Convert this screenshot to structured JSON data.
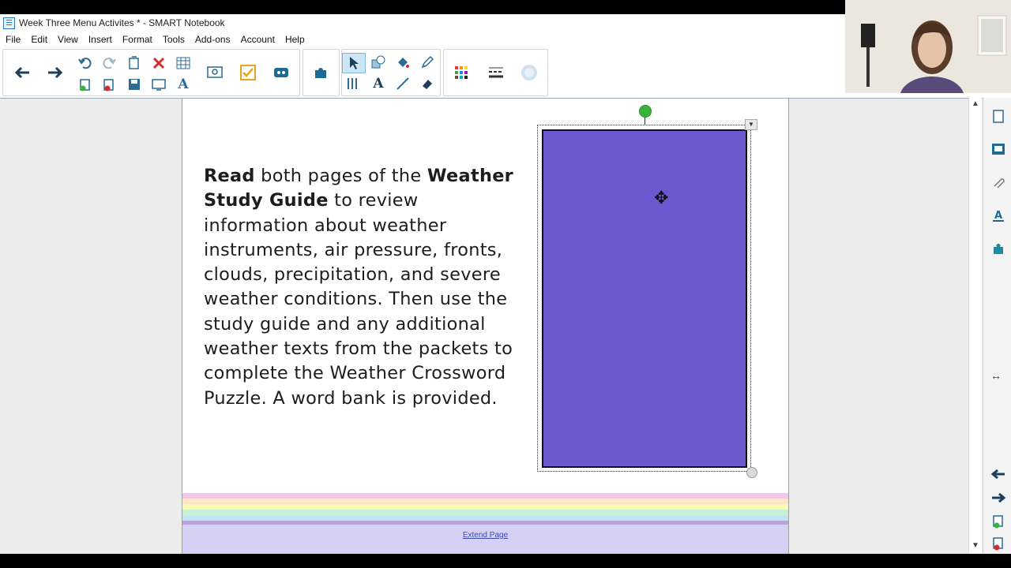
{
  "window": {
    "title": "Week Three Menu Activites * - SMART Notebook"
  },
  "menubar": {
    "items": [
      "File",
      "Edit",
      "View",
      "Insert",
      "Format",
      "Tools",
      "Add-ons",
      "Account",
      "Help"
    ]
  },
  "toolbar": {
    "buttons": [
      "back-arrow-icon",
      "forward-arrow-icon",
      "undo-icon",
      "redo-icon",
      "new-page-icon",
      "delete-icon",
      "table-icon",
      "open-icon",
      "save-icon",
      "screen-shade-icon",
      "text-icon",
      "document-camera-icon",
      "activity-builder-icon",
      "response-icon",
      "add-ons-icon",
      "select-icon",
      "pen-icon",
      "shapes-icon",
      "fill-icon",
      "eraser-icon",
      "line-icon",
      "properties-icon",
      "color-palette-icon",
      "line-style-icon",
      "transparency-icon"
    ]
  },
  "page": {
    "instruction_parts": [
      {
        "text": "Read",
        "bold": true
      },
      {
        "text": " both pages of the ",
        "bold": false
      },
      {
        "text": "Weather Study Guide",
        "bold": true
      },
      {
        "text": " to review information about weather instruments, air pressure, fronts, clouds, precipitation, and severe weather conditions. Then use the study guide and any additional weather texts from the packets to complete the Weather Crossword Puzzle. A word bank is provided.",
        "bold": false
      }
    ],
    "shape_color": "#6c58cf",
    "extend_link": "Extend Page",
    "stripe_colors": [
      "#f7c6ee",
      "#fde7c6",
      "#fdfbb3",
      "#c8f2d6",
      "#bfe6f5",
      "#b9a3d8",
      "#d6d0f5"
    ]
  },
  "sidebar": {
    "buttons": [
      "page-sorter-icon",
      "gallery-icon",
      "attachments-icon",
      "properties-icon",
      "add-ons-icon",
      "page-back-icon",
      "page-forward-icon",
      "add-page-icon",
      "delete-page-icon"
    ]
  }
}
